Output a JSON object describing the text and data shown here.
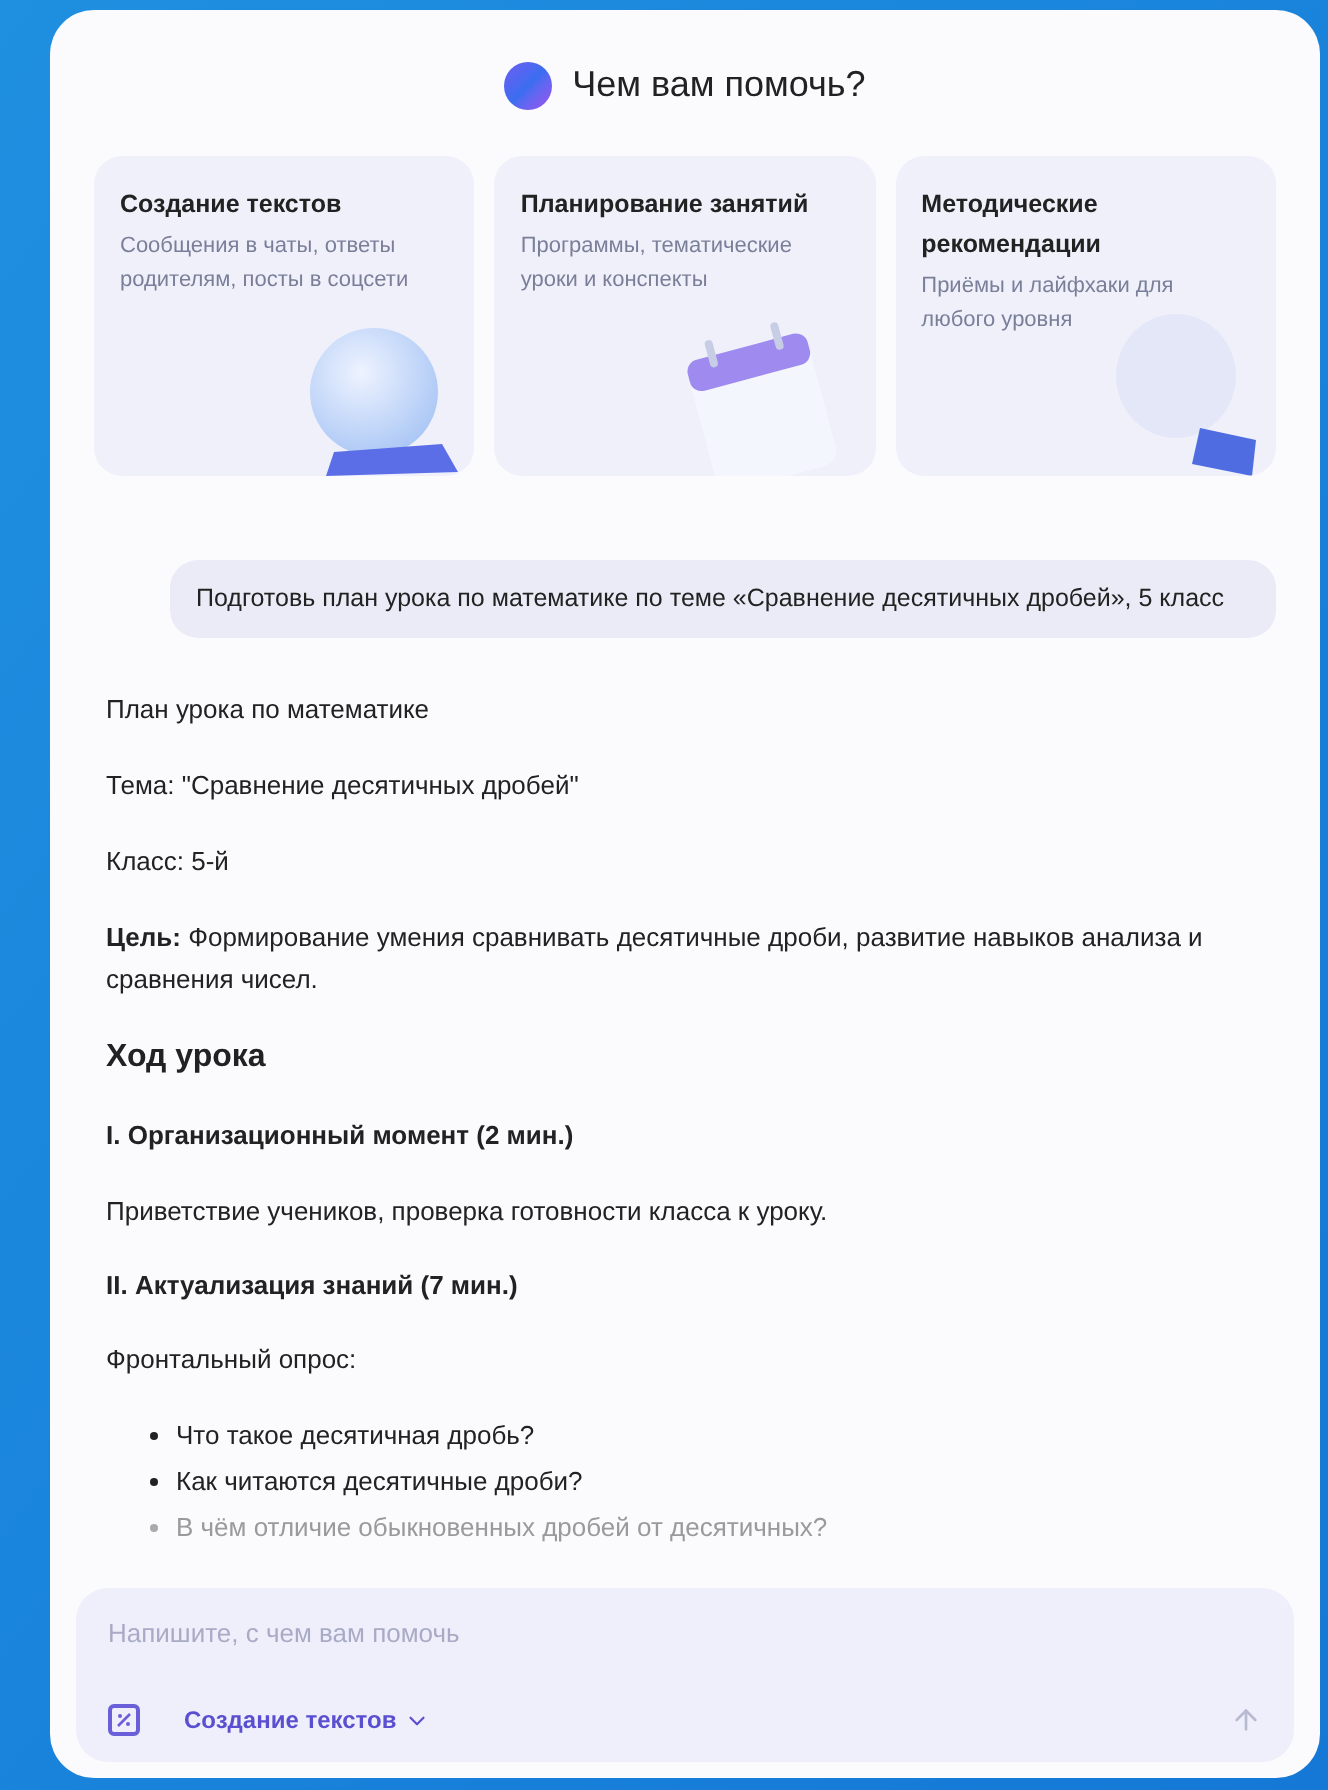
{
  "header": {
    "title": "Чем вам помочь?"
  },
  "cards": [
    {
      "kind": "sphere",
      "title": "Создание текстов",
      "description": "Сообщения в чаты, ответы родителям, посты в соцсети"
    },
    {
      "kind": "calendar",
      "title": "Планирование занятий",
      "description": "Программы, тематические уроки и конспекты"
    },
    {
      "kind": "bulb",
      "title": "Методические рекомендации",
      "description": "Приёмы и лайфхаки для любого уровня"
    }
  ],
  "user_message": "Подготовь план урока по математике по теме «Сравнение десятичных дробей», 5 класс",
  "answer": [
    {
      "kind": "paragraph",
      "text": "План урока по математике"
    },
    {
      "kind": "paragraph",
      "text": "Тема: \"Сравнение десятичных дробей\""
    },
    {
      "kind": "paragraph",
      "text": "Класс: 5-й"
    },
    {
      "kind": "paragraph",
      "text": "**Цель:** Формирование умения сравнивать десятичные дроби, развитие навыков анализа и сравнения чисел."
    },
    {
      "kind": "heading",
      "text": "Ход урока"
    },
    {
      "kind": "subheading",
      "text": "I. Организационный момент (2 мин.)"
    },
    {
      "kind": "paragraph",
      "text": "Приветствие учеников, проверка готовности класса к уроку."
    },
    {
      "kind": "subheading",
      "text": "II. Актуализация знаний (7 мин.)"
    },
    {
      "kind": "paragraph",
      "text": "Фронтальный опрос:"
    },
    {
      "kind": "list",
      "items": [
        {
          "text": "Что такое десятичная дробь?",
          "faded": false
        },
        {
          "text": "Как читаются десятичные дроби?",
          "faded": false
        },
        {
          "text": "В чём отличие обыкновенных дробей от десятичных?",
          "faded": true
        }
      ]
    }
  ],
  "composer": {
    "placeholder": "Напишите, с чем вам помочь",
    "mode_label": "Создание текстов"
  }
}
